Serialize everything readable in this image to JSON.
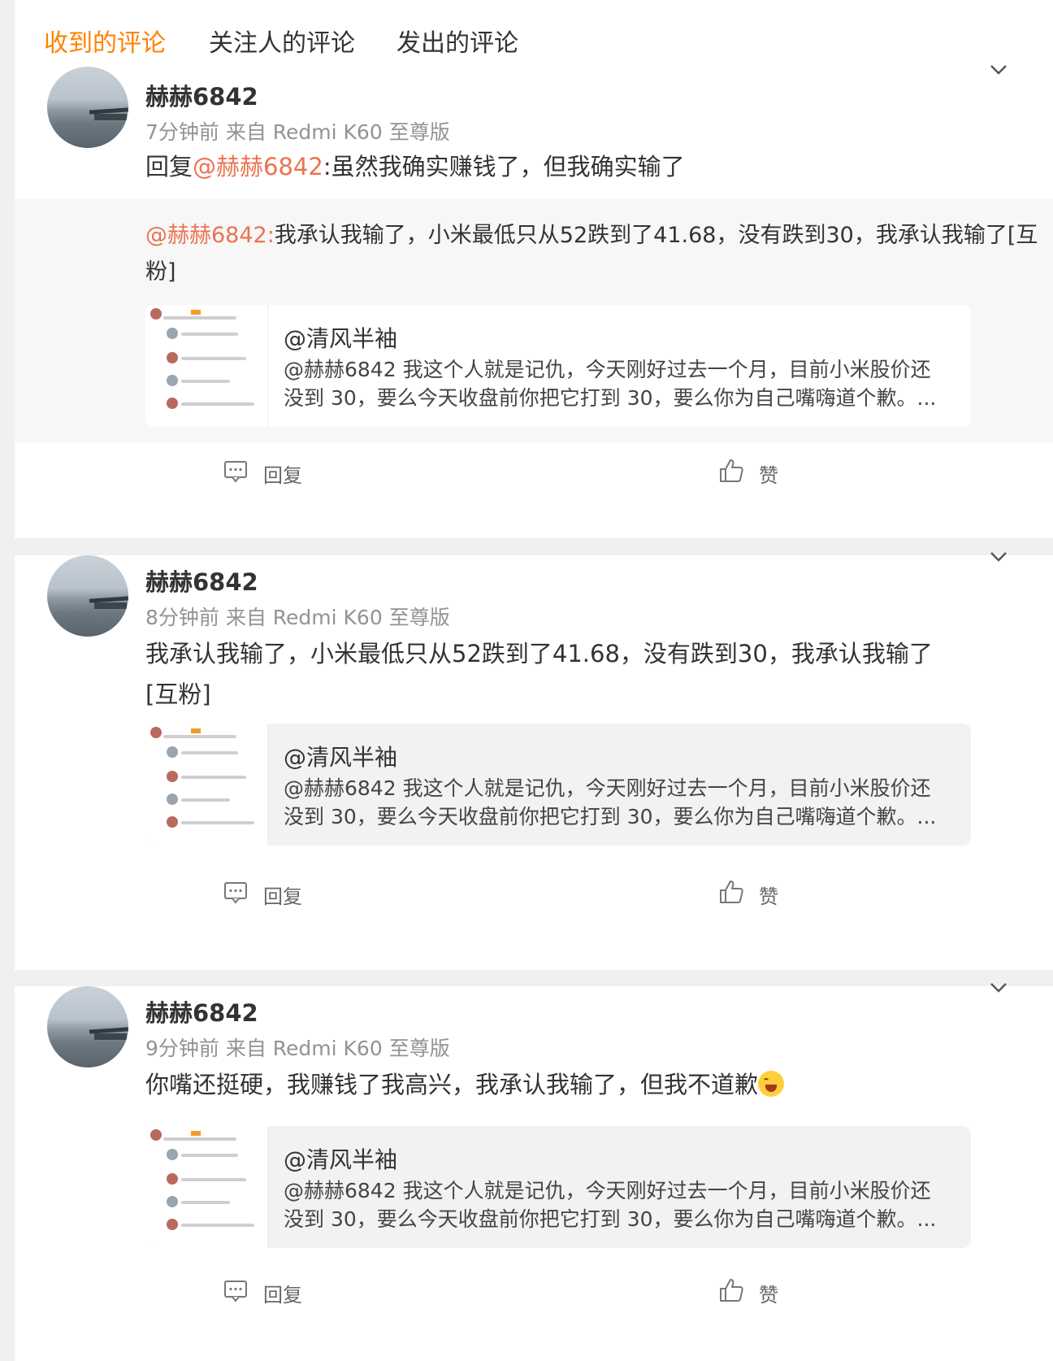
{
  "tabs": [
    {
      "label": "收到的评论",
      "active": true
    },
    {
      "label": "关注人的评论",
      "active": false
    },
    {
      "label": "发出的评论",
      "active": false
    }
  ],
  "comments": [
    {
      "name": "赫赫6842",
      "meta": "7分钟前  来自 Redmi K60 至尊版",
      "reply_prefix": "回复",
      "mention": "@赫赫6842",
      "text": ":虽然我确实赚钱了，但我确实输了",
      "quote_mention": "@赫赫6842:",
      "quote_text": "我承认我输了，小米最低只从52跌到了41.68，没有跌到30，我承认我输了[互粉]",
      "share_title": "@清风半袖",
      "share_desc": "@赫赫6842 我这个人就是记仇，今天刚好过去一个月，目前小米股价还没到 30，要么今天收盘前你把它打到 30，要么你为自己嘴嗨道个歉。..."
    },
    {
      "name": "赫赫6842",
      "meta": "8分钟前  来自 Redmi K60 至尊版",
      "text": "我承认我输了，小米最低只从52跌到了41.68，没有跌到30，我承认我输了[互粉]",
      "share_title": "@清风半袖",
      "share_desc": "@赫赫6842 我这个人就是记仇，今天刚好过去一个月，目前小米股价还没到 30，要么今天收盘前你把它打到 30，要么你为自己嘴嗨道个歉。..."
    },
    {
      "name": "赫赫6842",
      "meta": "9分钟前  来自 Redmi K60 至尊版",
      "text": "你嘴还挺硬，我赚钱了我高兴，我承认我输了，但我不道歉",
      "share_title": "@清风半袖",
      "share_desc": "@赫赫6842 我这个人就是记仇，今天刚好过去一个月，目前小米股价还没到 30，要么今天收盘前你把它打到 30，要么你为自己嘴嗨道个歉。..."
    }
  ],
  "actions": {
    "reply": "回复",
    "like": "赞"
  },
  "icons": {
    "chevron": "chevron-down-icon",
    "reply": "comment-icon",
    "like": "thumbs-up-icon",
    "emoji": "crying-laugh-emoji"
  },
  "colors": {
    "accent": "#ff8200",
    "mention": "#eb7350",
    "background": "#f0f0f0"
  }
}
